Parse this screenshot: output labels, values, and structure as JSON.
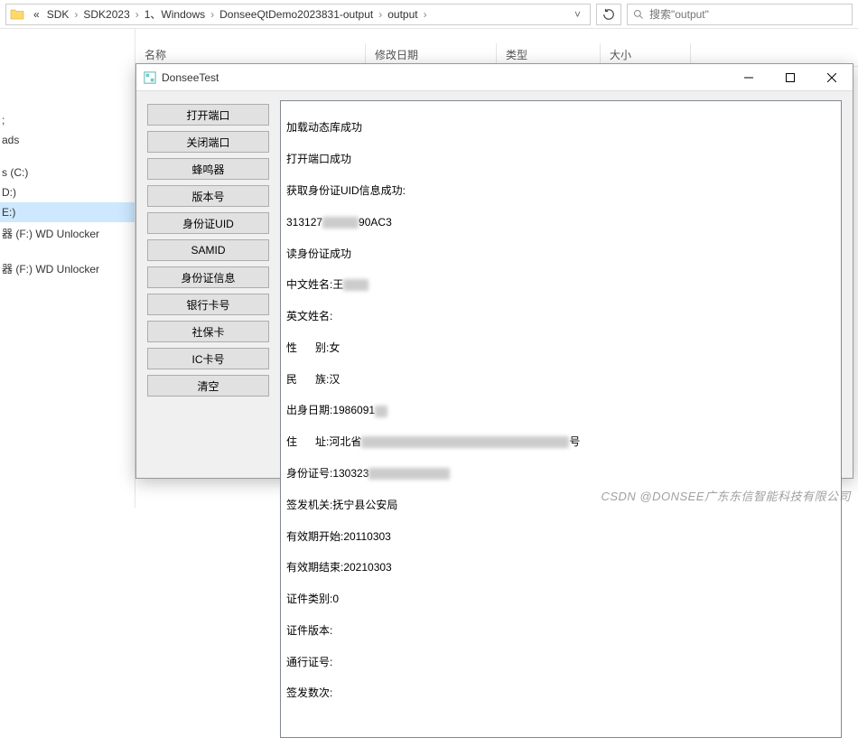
{
  "breadcrumb": {
    "prefix": "«",
    "items": [
      "SDK",
      "SDK2023",
      "1、Windows",
      "DonseeQtDemo2023831-output",
      "output"
    ]
  },
  "search": {
    "placeholder": "搜索\"output\""
  },
  "columns": {
    "name": "名称",
    "date": "修改日期",
    "type": "类型",
    "size": "大小"
  },
  "sidebar": {
    "items": [
      {
        "label": ";"
      },
      {
        "label": "ads"
      },
      {
        "label": "s (C:)"
      },
      {
        "label": "D:)"
      },
      {
        "label": "E:)",
        "selected": true
      },
      {
        "label": "器 (F:) WD Unlocker"
      },
      {
        "label": "器 (F:) WD Unlocker"
      }
    ]
  },
  "app": {
    "title": "DonseeTest",
    "buttons": [
      "打开端口",
      "关闭端口",
      "蜂鸣器",
      "版本号",
      "身份证UID",
      "SAMID",
      "身份证信息",
      "银行卡号",
      "社保卡",
      "IC卡号",
      "清空"
    ],
    "output": {
      "line1": "加载动态库成功",
      "line2": "打开端口成功",
      "line3": "获取身份证UID信息成功:",
      "line4a": "313127",
      "line4b": "90AC3",
      "line5": "读身份证成功",
      "line6a": "中文姓名:王",
      "line7": "英文姓名:",
      "line8": "性      别:女",
      "line9": "民      族:汉",
      "line10": "出身日期:1986091",
      "line11a": "住      址:河北省",
      "line11b": "号",
      "line12": "身份证号:130323",
      "line13": "签发机关:抚宁县公安局",
      "line14": "有效期开始:20110303",
      "line15": "有效期结束:20210303",
      "line16": "证件类别:0",
      "line17": "证件版本:",
      "line18": "通行证号:",
      "line19": "签发数次:"
    }
  },
  "watermark": "CSDN @DONSEE广东东信智能科技有限公司"
}
